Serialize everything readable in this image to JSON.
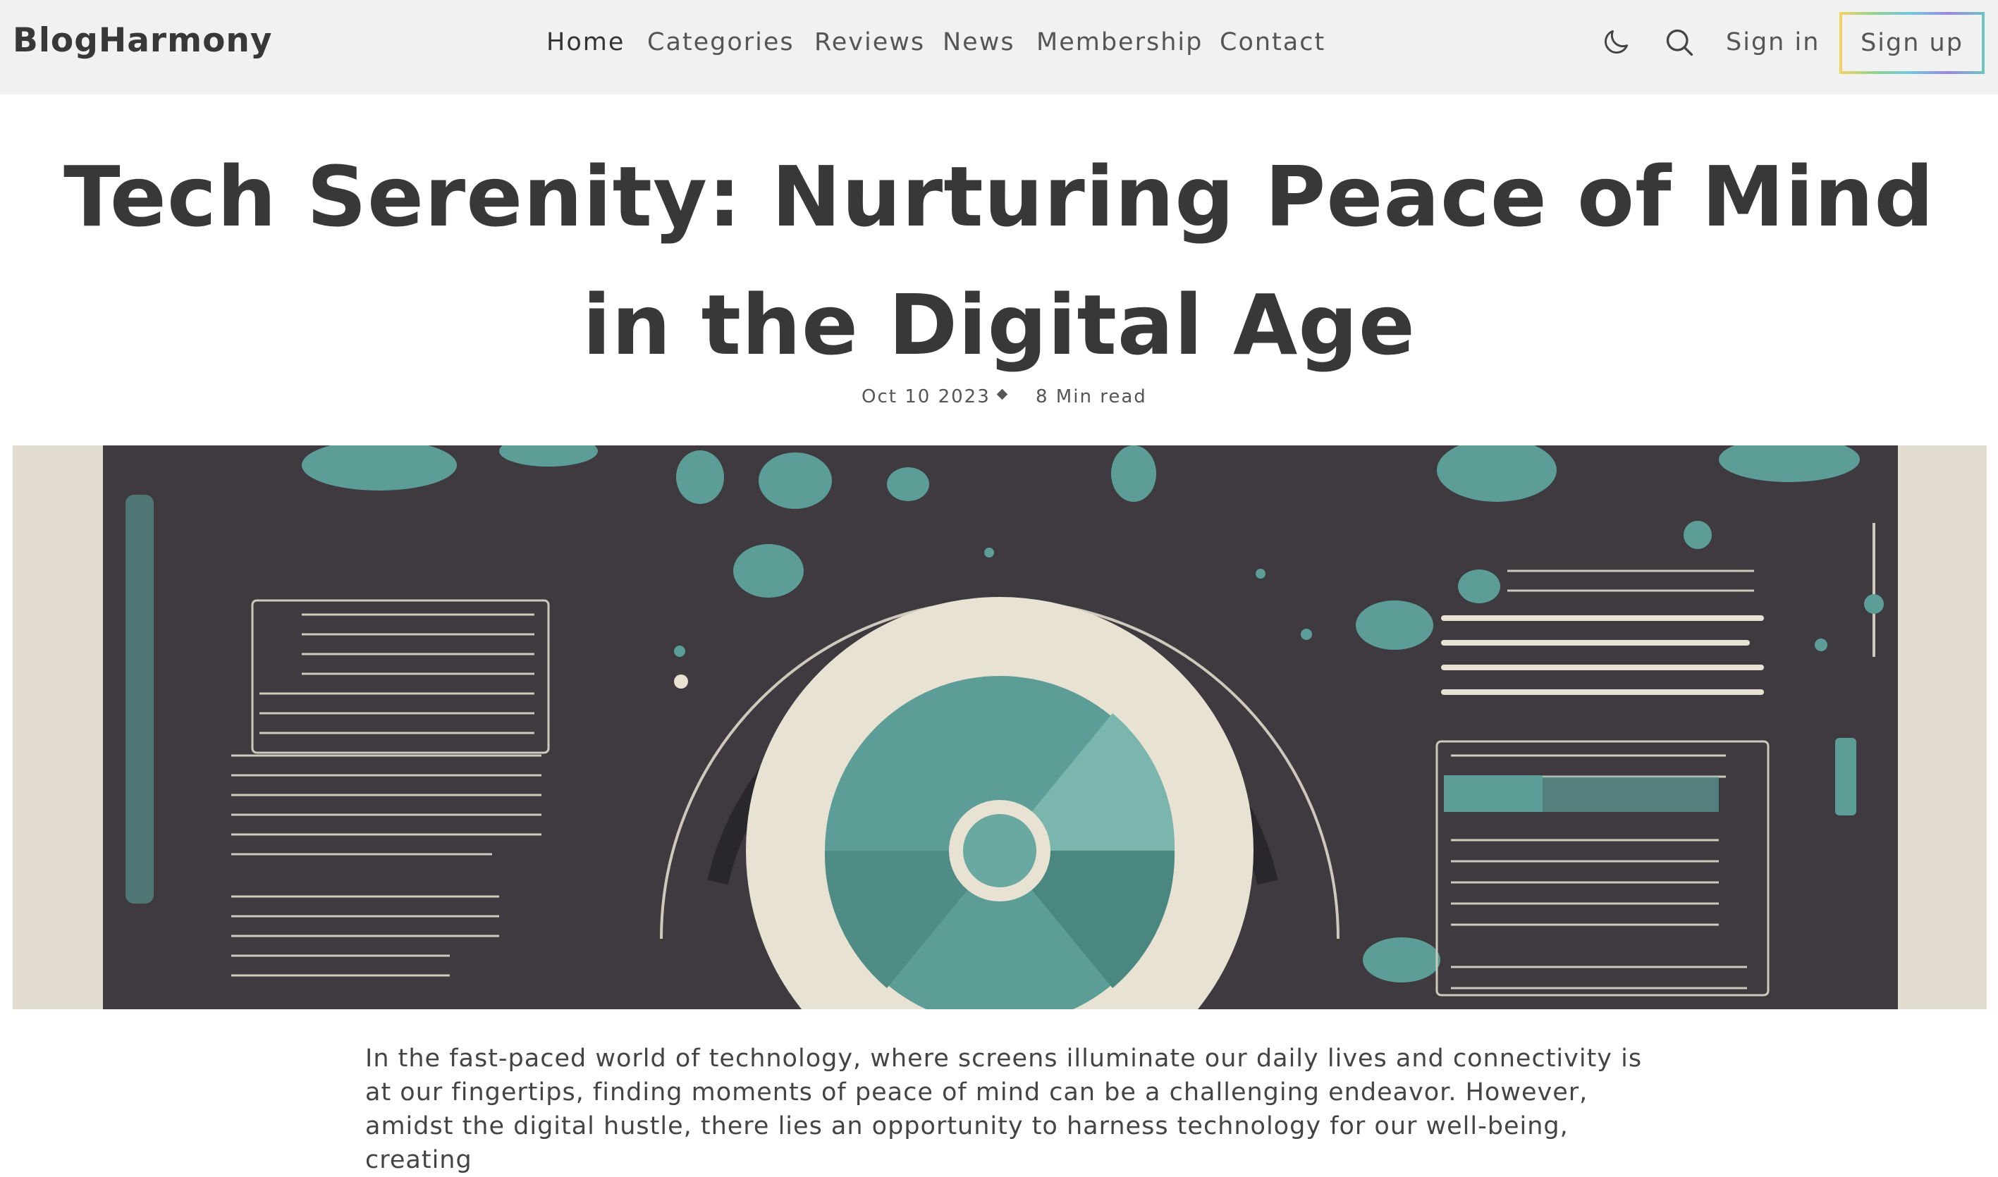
{
  "header": {
    "logo": "BlogHarmony",
    "nav": [
      {
        "label": "Home",
        "active": true
      },
      {
        "label": "Categories",
        "active": false
      },
      {
        "label": "Reviews",
        "active": false
      },
      {
        "label": "News",
        "active": false
      },
      {
        "label": "Membership",
        "active": false
      },
      {
        "label": "Contact",
        "active": false
      }
    ],
    "icons": [
      "moon-icon",
      "search-icon"
    ],
    "signin_label": "Sign in",
    "signup_label": "Sign up"
  },
  "article": {
    "title": "Tech Serenity: Nurturing Peace of Mind in the Digital Age",
    "date": "Oct 10 2023",
    "read_time": "8 Min read",
    "intro": "In the fast-paced world of technology, where screens illuminate our daily lives and connectivity is at our fingertips, finding moments of peace of mind can be a challenging endeavor. However, amidst the digital hustle, there lies an opportunity to harness technology for our well-being, creating"
  },
  "colors": {
    "header_bg": "#f1f1f1",
    "text": "#383838",
    "hero_dark": "#3e3a3f",
    "hero_teal": "#5c9e97",
    "hero_cream": "#e8e2d3"
  }
}
